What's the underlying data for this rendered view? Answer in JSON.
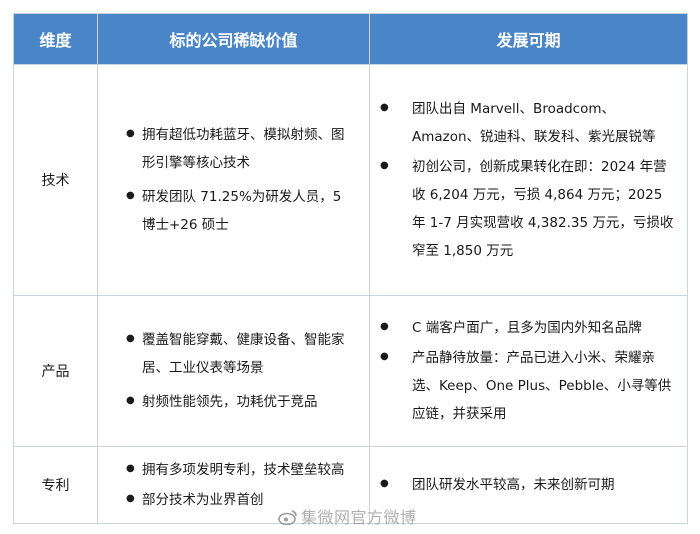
{
  "table": {
    "headers": [
      "维度",
      "标的公司稀缺价值",
      "发展可期"
    ],
    "rows": [
      {
        "dimension": "技术",
        "value_points": [
          "拥有超低功耗蓝牙、模拟射频、图形引擎等核心技术",
          "研发团队 71.25%为研发人员，5博士+26 硕士"
        ],
        "outlook_points": [
          "团队出自 Marvell、Broadcom、Amazon、锐迪科、联发科、紫光展锐等",
          "初创公司，创新成果转化在即：2024 年营收 6,204 万元，亏损 4,864 万元；2025 年 1-7 月实现营收 4,382.35 万元，亏损收窄至 1,850 万元"
        ]
      },
      {
        "dimension": "产品",
        "value_points": [
          "覆盖智能穿戴、健康设备、智能家居、工业仪表等场景",
          "射频性能领先，功耗优于竞品"
        ],
        "outlook_points": [
          "C 端客户面广，且多为国内外知名品牌",
          "产品静待放量：产品已进入小米、荣耀亲选、Keep、One Plus、Pebble、小寻等供应链，并获采用"
        ]
      },
      {
        "dimension": "专利",
        "value_points": [
          "拥有多项发明专利，技术壁垒较高",
          "部分技术为业界首创"
        ],
        "outlook_points": [
          "团队研发水平较高，未来创新可期"
        ]
      }
    ]
  },
  "bullet_glyph": "●",
  "watermark": "集微网官方微博",
  "colors": {
    "header_bg": "#4a86c7",
    "header_text": "#ffffff",
    "border": "#c9d4e3"
  }
}
